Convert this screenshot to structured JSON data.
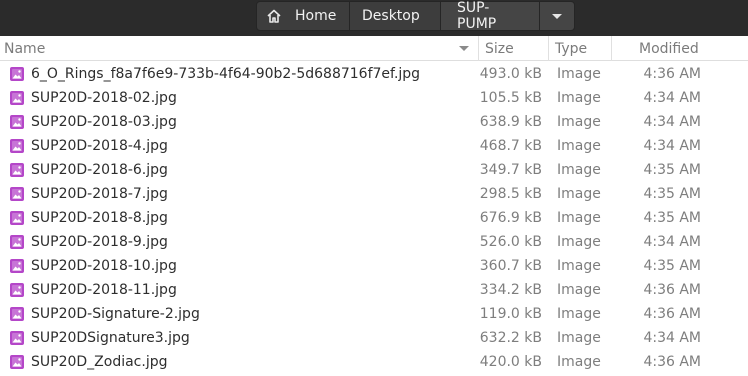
{
  "pathbar": {
    "home_label": "Home",
    "desktop_label": "Desktop",
    "current_label": "SUP-PUMP",
    "home_icon": "home-icon",
    "menu_icon": "chevron-down-icon"
  },
  "columns": {
    "name": "Name",
    "size": "Size",
    "type": "Type",
    "modified": "Modified"
  },
  "colors": {
    "headerbar": "#2b2b2b",
    "file_icon": "#b446c8"
  },
  "files": [
    {
      "name": "6_O_Rings_f8a7f6e9-733b-4f64-90b2-5d688716f7ef.jpg",
      "size": "493.0 kB",
      "type": "Image",
      "modified": "4:36 AM"
    },
    {
      "name": "SUP20D-2018-02.jpg",
      "size": "105.5 kB",
      "type": "Image",
      "modified": "4:34 AM"
    },
    {
      "name": "SUP20D-2018-03.jpg",
      "size": "638.9 kB",
      "type": "Image",
      "modified": "4:34 AM"
    },
    {
      "name": "SUP20D-2018-4.jpg",
      "size": "468.7 kB",
      "type": "Image",
      "modified": "4:34 AM"
    },
    {
      "name": "SUP20D-2018-6.jpg",
      "size": "349.7 kB",
      "type": "Image",
      "modified": "4:35 AM"
    },
    {
      "name": "SUP20D-2018-7.jpg",
      "size": "298.5 kB",
      "type": "Image",
      "modified": "4:35 AM"
    },
    {
      "name": "SUP20D-2018-8.jpg",
      "size": "676.9 kB",
      "type": "Image",
      "modified": "4:35 AM"
    },
    {
      "name": "SUP20D-2018-9.jpg",
      "size": "526.0 kB",
      "type": "Image",
      "modified": "4:34 AM"
    },
    {
      "name": "SUP20D-2018-10.jpg",
      "size": "360.7 kB",
      "type": "Image",
      "modified": "4:35 AM"
    },
    {
      "name": "SUP20D-2018-11.jpg",
      "size": "334.2 kB",
      "type": "Image",
      "modified": "4:36 AM"
    },
    {
      "name": "SUP20D-Signature-2.jpg",
      "size": "119.0 kB",
      "type": "Image",
      "modified": "4:36 AM"
    },
    {
      "name": "SUP20DSignature3.jpg",
      "size": "632.2 kB",
      "type": "Image",
      "modified": "4:34 AM"
    },
    {
      "name": "SUP20D_Zodiac.jpg",
      "size": "420.0 kB",
      "type": "Image",
      "modified": "4:36 AM"
    }
  ]
}
